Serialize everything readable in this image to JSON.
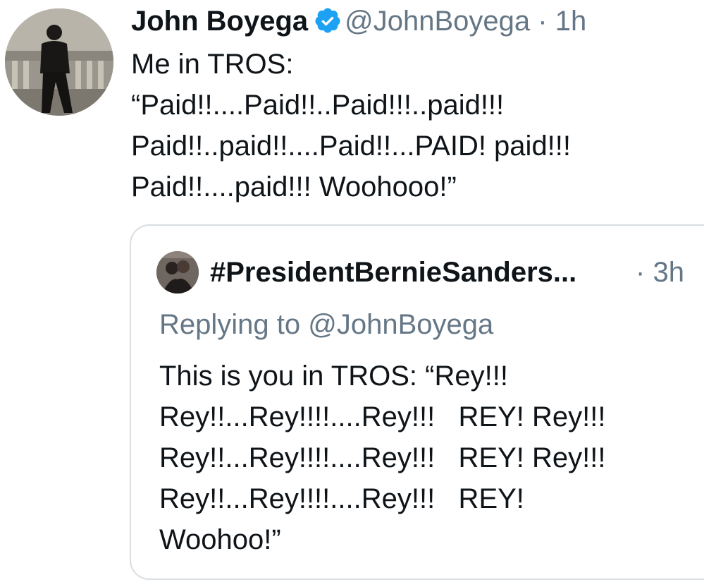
{
  "tweet": {
    "display_name": "John Boyega",
    "handle": "@JohnBoyega",
    "separator": "·",
    "timestamp": "1h",
    "verified_color": "#1da1f2",
    "avatar_icon": "profile-photo",
    "text_lines": [
      "Me in TROS:",
      "“Paid!!....Paid!!..Paid!!!..paid!!!",
      "Paid!!..paid!!....Paid!!...PAID! paid!!!",
      "Paid!!....paid!!! Woohooo!”"
    ]
  },
  "quoted_tweet": {
    "display_name": "#PresidentBernieSanders...",
    "separator": "·",
    "timestamp": "3h",
    "replying_to": "Replying to @JohnBoyega",
    "avatar_icon": "profile-photo",
    "text_lines": [
      "This is you in TROS: “Rey!!!",
      "Rey!!...Rey!!!!....Rey!!!   REY! Rey!!!",
      "Rey!!...Rey!!!!....Rey!!!   REY! Rey!!!",
      "Rey!!...Rey!!!!....Rey!!!   REY!",
      "Woohoo!”"
    ]
  }
}
